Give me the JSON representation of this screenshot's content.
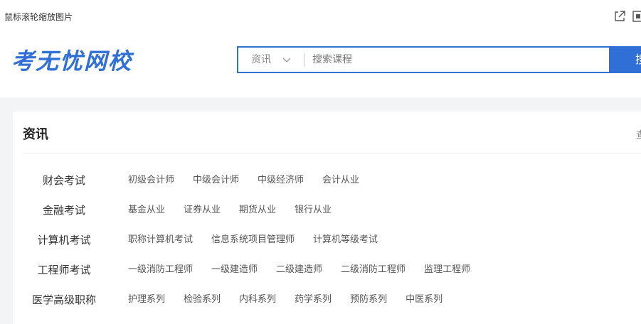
{
  "window": {
    "title": "鼠标滚轮缩放图片",
    "icons": [
      "external-link-icon",
      "fit-screen-icon"
    ]
  },
  "header": {
    "logo": "考无忧网校",
    "search": {
      "category": "资讯",
      "placeholder": "搜索课程",
      "button_label": "搜"
    }
  },
  "section": {
    "title": "资讯",
    "more_label": "查",
    "categories": [
      {
        "label": "财会考试",
        "items": [
          "初级会计师",
          "中级会计师",
          "中级经济师",
          "会计从业"
        ]
      },
      {
        "label": "金融考试",
        "items": [
          "基金从业",
          "证券从业",
          "期货从业",
          "银行从业"
        ]
      },
      {
        "label": "计算机考试",
        "items": [
          "职称计算机考试",
          "信息系统项目管理师",
          "计算机等级考试"
        ]
      },
      {
        "label": "工程师考试",
        "items": [
          "一级消防工程师",
          "一级建造师",
          "二级建造师",
          "二级消防工程师",
          "监理工程师"
        ]
      },
      {
        "label": "医学高级职称",
        "items": [
          "护理系列",
          "检验系列",
          "内科系列",
          "药学系列",
          "预防系列",
          "中医系列"
        ]
      }
    ]
  },
  "colors": {
    "brand_blue": "#2f6fd6",
    "background_grey": "#f3f4f6"
  }
}
